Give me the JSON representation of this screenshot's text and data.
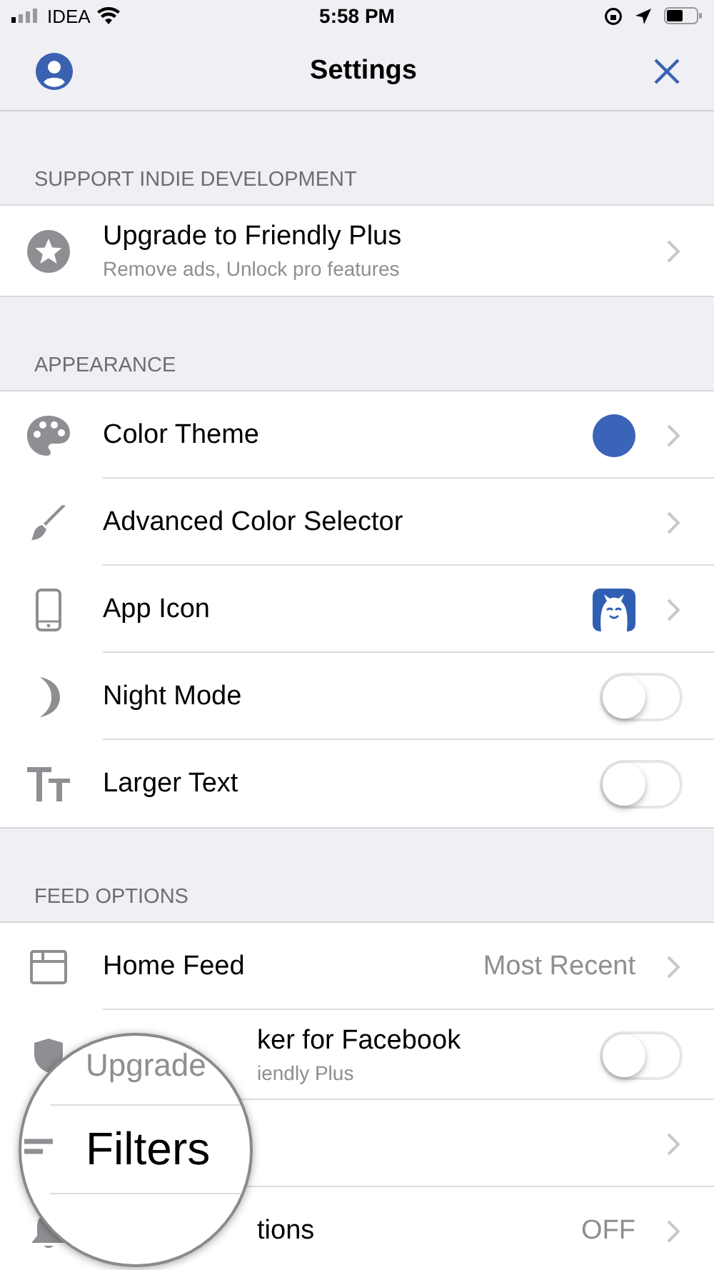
{
  "status_bar": {
    "carrier": "IDEA",
    "time": "5:58 PM"
  },
  "nav": {
    "title": "Settings"
  },
  "sections": [
    {
      "header": "SUPPORT INDIE DEVELOPMENT",
      "rows": [
        {
          "title": "Upgrade to Friendly Plus",
          "subtitle": "Remove ads, Unlock pro features",
          "kind": "link"
        }
      ]
    },
    {
      "header": "APPEARANCE",
      "rows": [
        {
          "title": "Color Theme",
          "kind": "color",
          "color": "#3b63b8"
        },
        {
          "title": "Advanced Color Selector",
          "kind": "link"
        },
        {
          "title": "App Icon",
          "kind": "app_icon"
        },
        {
          "title": "Night Mode",
          "kind": "toggle",
          "on": false
        },
        {
          "title": "Larger Text",
          "kind": "toggle",
          "on": false
        }
      ]
    },
    {
      "header": "FEED OPTIONS",
      "rows": [
        {
          "title": "Home Feed",
          "kind": "value",
          "value": "Most Recent"
        },
        {
          "title": "ker for Facebook",
          "subtitle": "iendly Plus",
          "kind": "toggle",
          "on": false
        },
        {
          "kind": "link"
        },
        {
          "title": "tions",
          "kind": "value",
          "value": "OFF"
        }
      ]
    }
  ],
  "magnifier": {
    "texts": [
      "Upgrade",
      "Filters"
    ]
  }
}
